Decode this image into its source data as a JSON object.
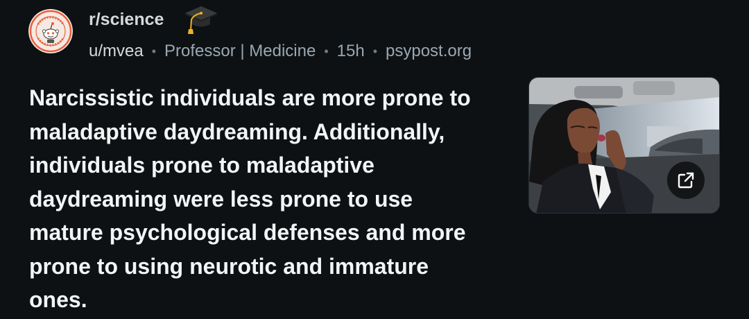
{
  "post": {
    "subreddit": "r/science",
    "author": "u/mvea",
    "author_flair": "Professor | Medicine",
    "separator": "•",
    "age": "15h",
    "domain": "psypost.org",
    "title": "Narcissistic individuals are more prone to maladaptive daydreaming. Additionally, individuals prone to maladaptive daydreaming were less prone to use mature psychological defenses and more prone to using neurotic and immature ones.",
    "subreddit_avatar_icon": "science-seal-icon",
    "flair_icon": "graduation-cap-icon",
    "thumbnail_icon": "external-link-icon"
  },
  "colors": {
    "background": "#0e1113",
    "title_text": "#f2f4f5",
    "meta_text": "#9aa8b2",
    "subreddit_text": "#d7dadc",
    "avatar_ring": "#e8603c"
  }
}
